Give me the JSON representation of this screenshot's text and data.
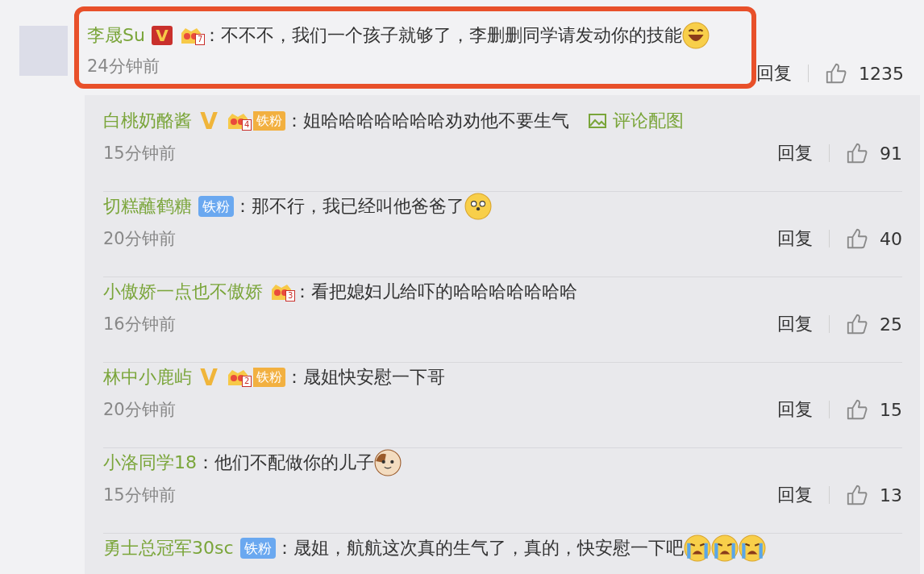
{
  "main_comment": {
    "user": "李晟Su",
    "highlighted": true,
    "badges": [
      {
        "kind": "verified_red",
        "label": "V"
      },
      {
        "kind": "crown",
        "rank": "7"
      }
    ],
    "text": "：不不不，我们一个孩子就够了，李删删同学请发动你的技能",
    "emojis": [
      {
        "kind": "laugh"
      }
    ],
    "time": "24分钟前",
    "reply": "回复",
    "likes": "1235"
  },
  "replies": [
    {
      "user": "白桃奶酪酱",
      "badges": [
        {
          "kind": "verified_yellow",
          "label": "V"
        },
        {
          "kind": "crown_fan",
          "rank": "4",
          "label": "铁粉"
        }
      ],
      "text": "：姐哈哈哈哈哈哈哈劝劝他不要生气",
      "image_link": "评论配图",
      "time": "15分钟前",
      "reply": "回复",
      "likes": "91"
    },
    {
      "user": "切糕蘸鹤糖",
      "badges": [
        {
          "kind": "fan",
          "label": "铁粉"
        }
      ],
      "text": "：那不行，我已经叫他爸爸了",
      "emojis": [
        {
          "kind": "doge"
        }
      ],
      "time": "20分钟前",
      "reply": "回复",
      "likes": "40"
    },
    {
      "user": "小傲娇一点也不傲娇",
      "badges": [
        {
          "kind": "crown",
          "rank": "3"
        }
      ],
      "text": "：看把媳妇儿给吓的哈哈哈哈哈哈哈",
      "time": "16分钟前",
      "reply": "回复",
      "likes": "25"
    },
    {
      "user": "林中小鹿屿",
      "badges": [
        {
          "kind": "verified_yellow",
          "label": "V"
        },
        {
          "kind": "crown_fan",
          "rank": "2",
          "label": "铁粉"
        }
      ],
      "text": "：晟姐快安慰一下哥",
      "time": "20分钟前",
      "reply": "回复",
      "likes": "15"
    },
    {
      "user": "小洛同学18",
      "text": "：他们不配做你的儿子",
      "emojis": [
        {
          "kind": "cat"
        }
      ],
      "time": "15分钟前",
      "reply": "回复",
      "likes": "13"
    },
    {
      "user": "勇士总冠军30sc",
      "badges": [
        {
          "kind": "fan",
          "label": "铁粉"
        }
      ],
      "text": "：晟姐，航航这次真的生气了，真的，快安慰一下吧",
      "emojis": [
        {
          "kind": "cry"
        },
        {
          "kind": "cry"
        },
        {
          "kind": "cry"
        }
      ]
    }
  ]
}
